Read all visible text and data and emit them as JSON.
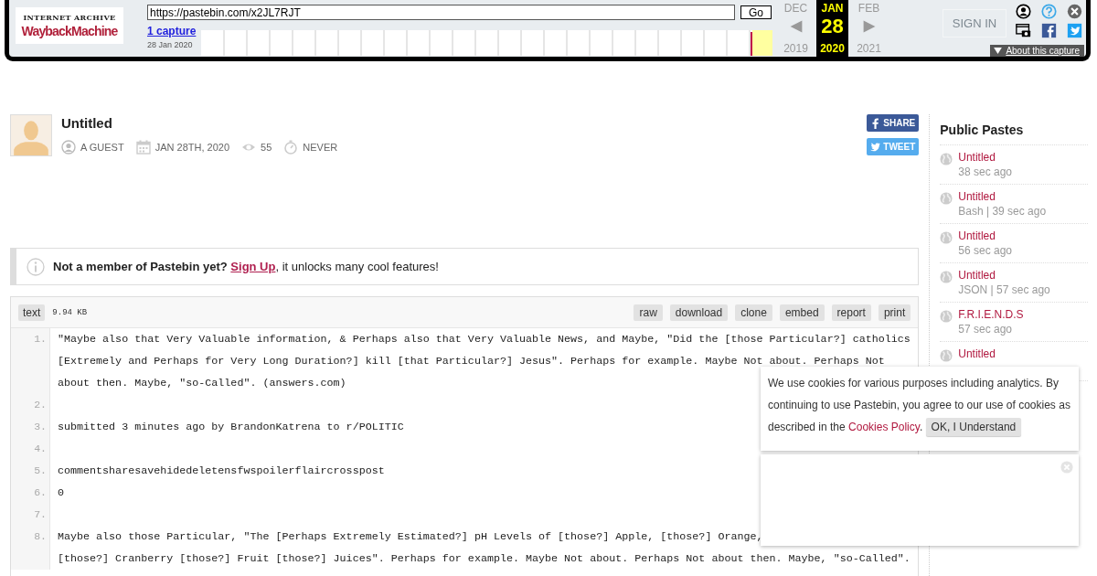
{
  "wayback": {
    "url": "https://pastebin.com/x2JL7RJT",
    "go_label": "Go",
    "captures_link": "1 capture",
    "capture_date": "28 Jan 2020",
    "months": [
      {
        "month": "DEC",
        "year": "2019",
        "selected": false
      },
      {
        "month": "JAN",
        "day": "28",
        "year": "2020",
        "selected": true
      },
      {
        "month": "FEB",
        "year": "2021",
        "selected": false
      }
    ],
    "about_label": "About this capture",
    "logo_top": "INTERNET ARCHIVE",
    "logo_bottom": "WaybackMachine"
  },
  "site_nav": {
    "sign_in": "SIGN IN"
  },
  "paste": {
    "title": "Untitled",
    "author": "A GUEST",
    "date": "JAN 28TH, 2020",
    "views": "55",
    "expires": "NEVER",
    "share_label": "SHARE",
    "tweet_label": "TWEET"
  },
  "notice": {
    "question": "Not a member of Pastebin yet?",
    "link": "Sign Up",
    "rest": ", it unlocks many cool features!"
  },
  "code": {
    "format": "text",
    "size": "9.94 KB",
    "actions": [
      "raw",
      "download",
      "clone",
      "embed",
      "report",
      "print"
    ],
    "lines": [
      {
        "number": "1.",
        "rows": [
          "\"Maybe also that Very Valuable information, & Perhaps also that Very Valuable News, and Maybe, \"Did the [those Particular?] catholics",
          "[Extremely and Perhaps for Very Long Duration?] kill [that Particular?] Jesus\". Perhaps for example. Maybe Not about. Perhaps Not",
          "about then. Maybe, \"so-Called\". (answers.com)"
        ]
      },
      {
        "number": "2."
      },
      {
        "number": "3.",
        "rows": [
          "submitted 3 minutes ago by BrandonKatrena to r/POLITIC"
        ]
      },
      {
        "number": "4."
      },
      {
        "number": "5.",
        "rows": [
          "commentsharesavehidedeletensfwspoilerflaircrosspost"
        ]
      },
      {
        "number": "6.",
        "rows": [
          "0"
        ]
      },
      {
        "number": "7."
      },
      {
        "number": "8.",
        "rows": [
          "Maybe also those Particular, \"The [Perhaps Extremely Estimated?] pH Levels of [those?] Apple, [those?] Orange,",
          "[those?] Cranberry [those?] Fruit [those?] Juices\". Perhaps for example. Maybe Not about. Perhaps Not about then. Maybe, \"so-Called\"."
        ]
      }
    ]
  },
  "sidebar": {
    "title": "Public Pastes",
    "items": [
      {
        "title": "Untitled",
        "meta": "38 sec ago"
      },
      {
        "title": "Untitled",
        "meta": "Bash | 39 sec ago"
      },
      {
        "title": "Untitled",
        "meta": "56 sec ago"
      },
      {
        "title": "Untitled",
        "meta": "JSON | 57 sec ago"
      },
      {
        "title": "F.R.I.E.N.D.S",
        "meta": "57 sec ago"
      },
      {
        "title": "Untitled"
      }
    ]
  },
  "cookie": {
    "text": "We use cookies for various purposes including analytics. By continuing to use Pastebin, you agree to our use of cookies as described in the",
    "link": "Cookies Policy",
    "end": ".",
    "button": "OK, I Understand"
  }
}
